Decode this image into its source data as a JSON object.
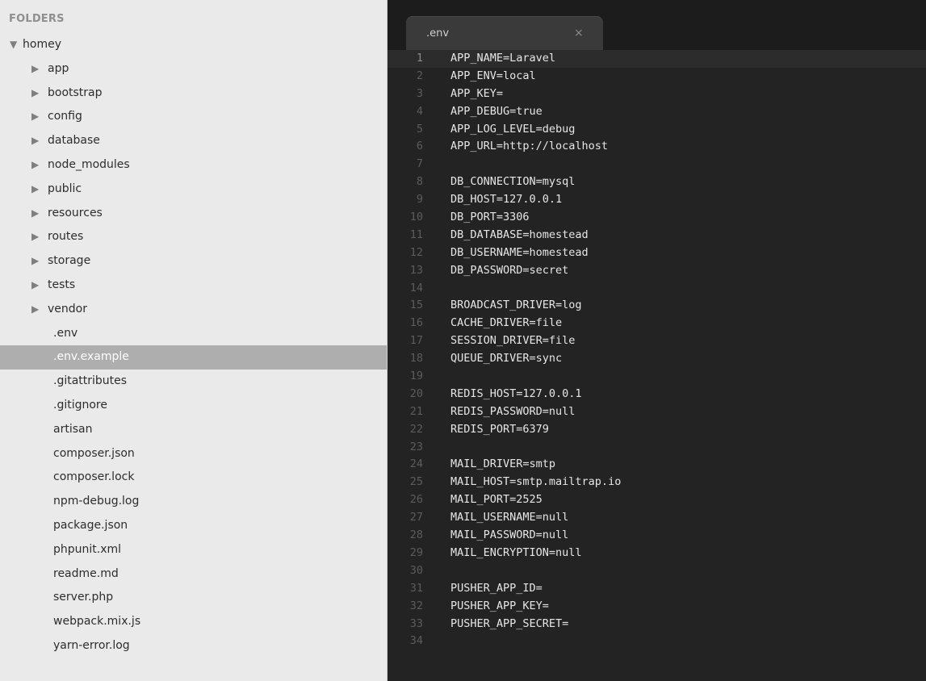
{
  "sidebar": {
    "header": "FOLDERS",
    "root": {
      "label": "homey",
      "expanded": true
    },
    "folders": [
      {
        "label": "app"
      },
      {
        "label": "bootstrap"
      },
      {
        "label": "config"
      },
      {
        "label": "database"
      },
      {
        "label": "node_modules"
      },
      {
        "label": "public"
      },
      {
        "label": "resources"
      },
      {
        "label": "routes"
      },
      {
        "label": "storage"
      },
      {
        "label": "tests"
      },
      {
        "label": "vendor"
      }
    ],
    "files": [
      {
        "label": ".env"
      },
      {
        "label": ".env.example",
        "selected": true
      },
      {
        "label": ".gitattributes"
      },
      {
        "label": ".gitignore"
      },
      {
        "label": "artisan"
      },
      {
        "label": "composer.json"
      },
      {
        "label": "composer.lock"
      },
      {
        "label": "npm-debug.log"
      },
      {
        "label": "package.json"
      },
      {
        "label": "phpunit.xml"
      },
      {
        "label": "readme.md"
      },
      {
        "label": "server.php"
      },
      {
        "label": "webpack.mix.js"
      },
      {
        "label": "yarn-error.log"
      }
    ],
    "icons": {
      "expanded": "triangle-down-icon",
      "collapsed": "triangle-right-icon"
    }
  },
  "editor": {
    "tab": {
      "label": ".env",
      "close": "×"
    },
    "current_line": 1,
    "lines": [
      {
        "n": "1",
        "text": "APP_NAME=Laravel"
      },
      {
        "n": "2",
        "text": "APP_ENV=local"
      },
      {
        "n": "3",
        "text": "APP_KEY="
      },
      {
        "n": "4",
        "text": "APP_DEBUG=true"
      },
      {
        "n": "5",
        "text": "APP_LOG_LEVEL=debug"
      },
      {
        "n": "6",
        "text": "APP_URL=http://localhost"
      },
      {
        "n": "7",
        "text": ""
      },
      {
        "n": "8",
        "text": "DB_CONNECTION=mysql"
      },
      {
        "n": "9",
        "text": "DB_HOST=127.0.0.1"
      },
      {
        "n": "10",
        "text": "DB_PORT=3306"
      },
      {
        "n": "11",
        "text": "DB_DATABASE=homestead"
      },
      {
        "n": "12",
        "text": "DB_USERNAME=homestead"
      },
      {
        "n": "13",
        "text": "DB_PASSWORD=secret"
      },
      {
        "n": "14",
        "text": ""
      },
      {
        "n": "15",
        "text": "BROADCAST_DRIVER=log"
      },
      {
        "n": "16",
        "text": "CACHE_DRIVER=file"
      },
      {
        "n": "17",
        "text": "SESSION_DRIVER=file"
      },
      {
        "n": "18",
        "text": "QUEUE_DRIVER=sync"
      },
      {
        "n": "19",
        "text": ""
      },
      {
        "n": "20",
        "text": "REDIS_HOST=127.0.0.1"
      },
      {
        "n": "21",
        "text": "REDIS_PASSWORD=null"
      },
      {
        "n": "22",
        "text": "REDIS_PORT=6379"
      },
      {
        "n": "23",
        "text": ""
      },
      {
        "n": "24",
        "text": "MAIL_DRIVER=smtp"
      },
      {
        "n": "25",
        "text": "MAIL_HOST=smtp.mailtrap.io"
      },
      {
        "n": "26",
        "text": "MAIL_PORT=2525"
      },
      {
        "n": "27",
        "text": "MAIL_USERNAME=null"
      },
      {
        "n": "28",
        "text": "MAIL_PASSWORD=null"
      },
      {
        "n": "29",
        "text": "MAIL_ENCRYPTION=null"
      },
      {
        "n": "30",
        "text": ""
      },
      {
        "n": "31",
        "text": "PUSHER_APP_ID="
      },
      {
        "n": "32",
        "text": "PUSHER_APP_KEY="
      },
      {
        "n": "33",
        "text": "PUSHER_APP_SECRET="
      },
      {
        "n": "34",
        "text": ""
      }
    ]
  },
  "colors": {
    "sidebar_bg": "#eaeaea",
    "selected_bg": "#aeaeae",
    "editor_bg": "#232323",
    "code_text": "#e6e6e6",
    "line_number": "#5c5c5c"
  }
}
